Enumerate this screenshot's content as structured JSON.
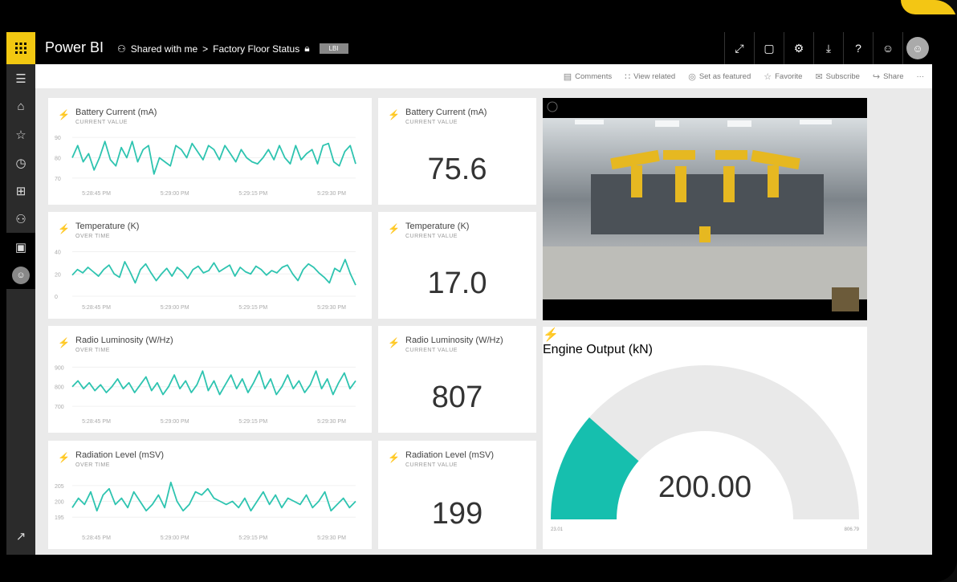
{
  "app": {
    "brand": "Power BI"
  },
  "breadcrumb": {
    "shared": "Shared with me",
    "separator": ">",
    "dashboard": "Factory Floor Status",
    "tag": "LBI"
  },
  "actions": [
    {
      "label": "Comments",
      "icon": "comment-icon"
    },
    {
      "label": "View related",
      "icon": "related-icon"
    },
    {
      "label": "Set as featured",
      "icon": "featured-icon"
    },
    {
      "label": "Favorite",
      "icon": "star-icon"
    },
    {
      "label": "Subscribe",
      "icon": "mail-icon"
    },
    {
      "label": "Share",
      "icon": "share-icon"
    },
    {
      "label": "···",
      "icon": "more-icon"
    }
  ],
  "line_tiles": [
    {
      "title": "Battery Current (mA)",
      "subtitle": "CURRENT VALUE"
    },
    {
      "title": "Temperature (K)",
      "subtitle": "OVER TIME"
    },
    {
      "title": "Radio Luminosity (W/Hz)",
      "subtitle": "OVER TIME"
    },
    {
      "title": "Radiation Level (mSV)",
      "subtitle": "OVER TIME"
    }
  ],
  "card_tiles": [
    {
      "title": "Battery Current (mA)",
      "subtitle": "CURRENT VALUE",
      "value": "75.6"
    },
    {
      "title": "Temperature (K)",
      "subtitle": "CURRENT VALUE",
      "value": "17.0"
    },
    {
      "title": "Radio Luminosity (W/Hz)",
      "subtitle": "CURRENT VALUE",
      "value": "807"
    },
    {
      "title": "Radiation Level (mSV)",
      "subtitle": "CURRENT VALUE",
      "value": "199"
    }
  ],
  "gauge": {
    "title": "Engine Output (kN)",
    "value": "200.00",
    "min_label": "23.01",
    "max_label": "806.79",
    "fill_fraction": 0.23
  },
  "colors": {
    "accent": "#f2c811",
    "line": "#2ec4b0",
    "gauge_fill": "#16bfae",
    "gauge_track": "#e9e9e9"
  },
  "chart_data": [
    {
      "type": "line",
      "title": "Battery Current (mA)",
      "x": [
        "5:28:45 PM",
        "5:29:00 PM",
        "5:29:15 PM",
        "5:29:30 PM"
      ],
      "ylim": [
        68,
        92
      ],
      "yticks": [
        "90",
        "80",
        "70"
      ],
      "series": [
        {
          "values": [
            80,
            86,
            78,
            82,
            74,
            80,
            88,
            79,
            76,
            85,
            80,
            88,
            78,
            84,
            86,
            72,
            80,
            78,
            76,
            86,
            84,
            80,
            87,
            83,
            79,
            86,
            84,
            79,
            86,
            82,
            78,
            84,
            80,
            78,
            77,
            80,
            84,
            79,
            86,
            80,
            77,
            86,
            79,
            82,
            84,
            77,
            86,
            87,
            78,
            76,
            83,
            86,
            77
          ]
        }
      ]
    },
    {
      "type": "line",
      "title": "Temperature (K)",
      "x": [
        "5:28:45 PM",
        "5:29:00 PM",
        "5:29:15 PM",
        "5:29:30 PM"
      ],
      "ylim": [
        0,
        44
      ],
      "yticks": [
        "40",
        "20",
        "0"
      ],
      "series": [
        {
          "values": [
            19,
            24,
            21,
            26,
            22,
            18,
            24,
            28,
            20,
            17,
            31,
            22,
            12,
            24,
            29,
            21,
            14,
            20,
            25,
            18,
            26,
            22,
            16,
            24,
            27,
            21,
            23,
            30,
            22,
            25,
            28,
            18,
            26,
            22,
            20,
            27,
            24,
            19,
            23,
            21,
            26,
            28,
            20,
            14,
            24,
            29,
            26,
            21,
            17,
            12,
            25,
            22,
            33,
            20,
            10
          ]
        }
      ]
    },
    {
      "type": "line",
      "title": "Radio Luminosity (W/Hz)",
      "x": [
        "5:28:45 PM",
        "5:29:00 PM",
        "5:29:15 PM",
        "5:29:30 PM"
      ],
      "ylim": [
        680,
        930
      ],
      "yticks": [
        "900",
        "800",
        "700"
      ],
      "series": [
        {
          "values": [
            800,
            830,
            790,
            820,
            780,
            810,
            770,
            800,
            840,
            790,
            820,
            770,
            810,
            850,
            780,
            820,
            760,
            800,
            860,
            790,
            830,
            770,
            810,
            880,
            780,
            830,
            760,
            810,
            860,
            790,
            840,
            770,
            820,
            880,
            790,
            840,
            760,
            800,
            860,
            790,
            830,
            770,
            810,
            880,
            790,
            840,
            760,
            820,
            870,
            790,
            830
          ]
        }
      ]
    },
    {
      "type": "line",
      "title": "Radiation Level (mSV)",
      "x": [
        "5:28:45 PM",
        "5:29:00 PM",
        "5:29:15 PM",
        "5:29:30 PM"
      ],
      "ylim": [
        192,
        208
      ],
      "yticks": [
        "205",
        "200",
        "195"
      ],
      "series": [
        {
          "values": [
            198,
            201,
            199,
            203,
            197,
            202,
            204,
            199,
            201,
            198,
            203,
            200,
            197,
            199,
            202,
            198,
            206,
            200,
            197,
            199,
            203,
            202,
            204,
            201,
            200,
            199,
            200,
            198,
            201,
            197,
            200,
            203,
            199,
            202,
            198,
            201,
            200,
            199,
            202,
            198,
            200,
            203,
            197,
            199,
            201,
            198,
            200
          ]
        }
      ]
    },
    {
      "type": "gauge",
      "title": "Engine Output (kN)",
      "value": 200.0,
      "min": 23.01,
      "max": 806.79
    }
  ]
}
